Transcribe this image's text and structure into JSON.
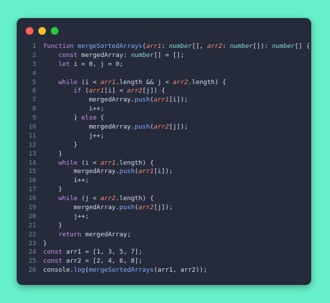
{
  "colors": {
    "background": "#66f0c9",
    "window": "#262b3c",
    "close_dot": "#ff5f57",
    "minimize_dot": "#febc2e",
    "maximize_dot": "#28c840",
    "line_number": "#7d8599",
    "keyword": "#c792ea",
    "function": "#82aaff",
    "parameter": "#f78c6c",
    "type": "#7fdbca",
    "text": "#d6dcea"
  },
  "window_controls": [
    "close",
    "minimize",
    "maximize"
  ],
  "code_lines": [
    {
      "n": "1",
      "t": [
        [
          "function ",
          "kw"
        ],
        [
          "mergeSortedArrays",
          "fn"
        ],
        [
          "(",
          "punct"
        ],
        [
          "arr1",
          "param"
        ],
        [
          ": ",
          "punct"
        ],
        [
          "number",
          "type"
        ],
        [
          "[], ",
          "punct"
        ],
        [
          "arr2",
          "param"
        ],
        [
          ": ",
          "punct"
        ],
        [
          "number",
          "type"
        ],
        [
          "[]): ",
          "punct"
        ],
        [
          "number",
          "type"
        ],
        [
          "[] {",
          "punct"
        ]
      ]
    },
    {
      "n": "2",
      "t": [
        [
          "    ",
          "punct"
        ],
        [
          "const ",
          "kw"
        ],
        [
          "mergedArray",
          "var"
        ],
        [
          ": ",
          "punct"
        ],
        [
          "number",
          "type"
        ],
        [
          "[] = [];",
          "punct"
        ]
      ]
    },
    {
      "n": "3",
      "t": [
        [
          "    ",
          "punct"
        ],
        [
          "let ",
          "kw"
        ],
        [
          "i = 0, j = 0;",
          "var"
        ]
      ]
    },
    {
      "n": "4",
      "t": [
        [
          "",
          "punct"
        ]
      ]
    },
    {
      "n": "5",
      "t": [
        [
          "    ",
          "punct"
        ],
        [
          "while ",
          "kw"
        ],
        [
          "(i < ",
          "var"
        ],
        [
          "arr1",
          "param"
        ],
        [
          ".length && j < ",
          "var"
        ],
        [
          "arr2",
          "param"
        ],
        [
          ".length) {",
          "var"
        ]
      ]
    },
    {
      "n": "6",
      "t": [
        [
          "        ",
          "punct"
        ],
        [
          "if ",
          "kw"
        ],
        [
          "(",
          "punct"
        ],
        [
          "arr1",
          "param"
        ],
        [
          "[i] < ",
          "var"
        ],
        [
          "arr2",
          "param"
        ],
        [
          "[j]) {",
          "var"
        ]
      ]
    },
    {
      "n": "7",
      "t": [
        [
          "            ",
          "punct"
        ],
        [
          "mergedArray.",
          "var"
        ],
        [
          "push",
          "method"
        ],
        [
          "(",
          "punct"
        ],
        [
          "arr1",
          "param"
        ],
        [
          "[i]);",
          "var"
        ]
      ]
    },
    {
      "n": "8",
      "t": [
        [
          "            ",
          "punct"
        ],
        [
          "i++;",
          "var"
        ]
      ]
    },
    {
      "n": "9",
      "t": [
        [
          "        ",
          "punct"
        ],
        [
          "} ",
          "punct"
        ],
        [
          "else ",
          "kw"
        ],
        [
          "{",
          "punct"
        ]
      ]
    },
    {
      "n": "10",
      "t": [
        [
          "            ",
          "punct"
        ],
        [
          "mergedArray.",
          "var"
        ],
        [
          "push",
          "method"
        ],
        [
          "(",
          "punct"
        ],
        [
          "arr2",
          "param"
        ],
        [
          "[j]);",
          "var"
        ]
      ]
    },
    {
      "n": "11",
      "t": [
        [
          "            ",
          "punct"
        ],
        [
          "j++;",
          "var"
        ]
      ]
    },
    {
      "n": "12",
      "t": [
        [
          "        ",
          "punct"
        ],
        [
          "}",
          "punct"
        ]
      ]
    },
    {
      "n": "13",
      "t": [
        [
          "    ",
          "punct"
        ],
        [
          "}",
          "punct"
        ]
      ]
    },
    {
      "n": "14",
      "t": [
        [
          "    ",
          "punct"
        ],
        [
          "while ",
          "kw"
        ],
        [
          "(i < ",
          "var"
        ],
        [
          "arr1",
          "param"
        ],
        [
          ".length) {",
          "var"
        ]
      ]
    },
    {
      "n": "15",
      "t": [
        [
          "        ",
          "punct"
        ],
        [
          "mergedArray.",
          "var"
        ],
        [
          "push",
          "method"
        ],
        [
          "(",
          "punct"
        ],
        [
          "arr1",
          "param"
        ],
        [
          "[i]);",
          "var"
        ]
      ]
    },
    {
      "n": "16",
      "t": [
        [
          "        ",
          "punct"
        ],
        [
          "i++;",
          "var"
        ]
      ]
    },
    {
      "n": "17",
      "t": [
        [
          "    ",
          "punct"
        ],
        [
          "}",
          "punct"
        ]
      ]
    },
    {
      "n": "18",
      "t": [
        [
          "    ",
          "punct"
        ],
        [
          "while ",
          "kw"
        ],
        [
          "(j < ",
          "var"
        ],
        [
          "arr2",
          "param"
        ],
        [
          ".length) {",
          "var"
        ]
      ]
    },
    {
      "n": "19",
      "t": [
        [
          "        ",
          "punct"
        ],
        [
          "mergedArray.",
          "var"
        ],
        [
          "push",
          "method"
        ],
        [
          "(",
          "punct"
        ],
        [
          "arr2",
          "param"
        ],
        [
          "[j]);",
          "var"
        ]
      ]
    },
    {
      "n": "20",
      "t": [
        [
          "        ",
          "punct"
        ],
        [
          "j++;",
          "var"
        ]
      ]
    },
    {
      "n": "21",
      "t": [
        [
          "    ",
          "punct"
        ],
        [
          "}",
          "punct"
        ]
      ]
    },
    {
      "n": "22",
      "t": [
        [
          "    ",
          "punct"
        ],
        [
          "return ",
          "kw"
        ],
        [
          "mergedArray;",
          "var"
        ]
      ]
    },
    {
      "n": "23",
      "t": [
        [
          "}",
          "punct"
        ]
      ]
    },
    {
      "n": "24",
      "t": [
        [
          "const ",
          "kw"
        ],
        [
          "arr1 = [1, 3, 5, 7];",
          "var"
        ]
      ]
    },
    {
      "n": "25",
      "t": [
        [
          "const ",
          "kw"
        ],
        [
          "arr2 = [2, 4, 6, 8];",
          "var"
        ]
      ]
    },
    {
      "n": "26",
      "t": [
        [
          "console.",
          "var"
        ],
        [
          "log",
          "method"
        ],
        [
          "(",
          "punct"
        ],
        [
          "mergeSortedArrays",
          "fn"
        ],
        [
          "(arr1, arr2));",
          "var"
        ]
      ]
    }
  ]
}
